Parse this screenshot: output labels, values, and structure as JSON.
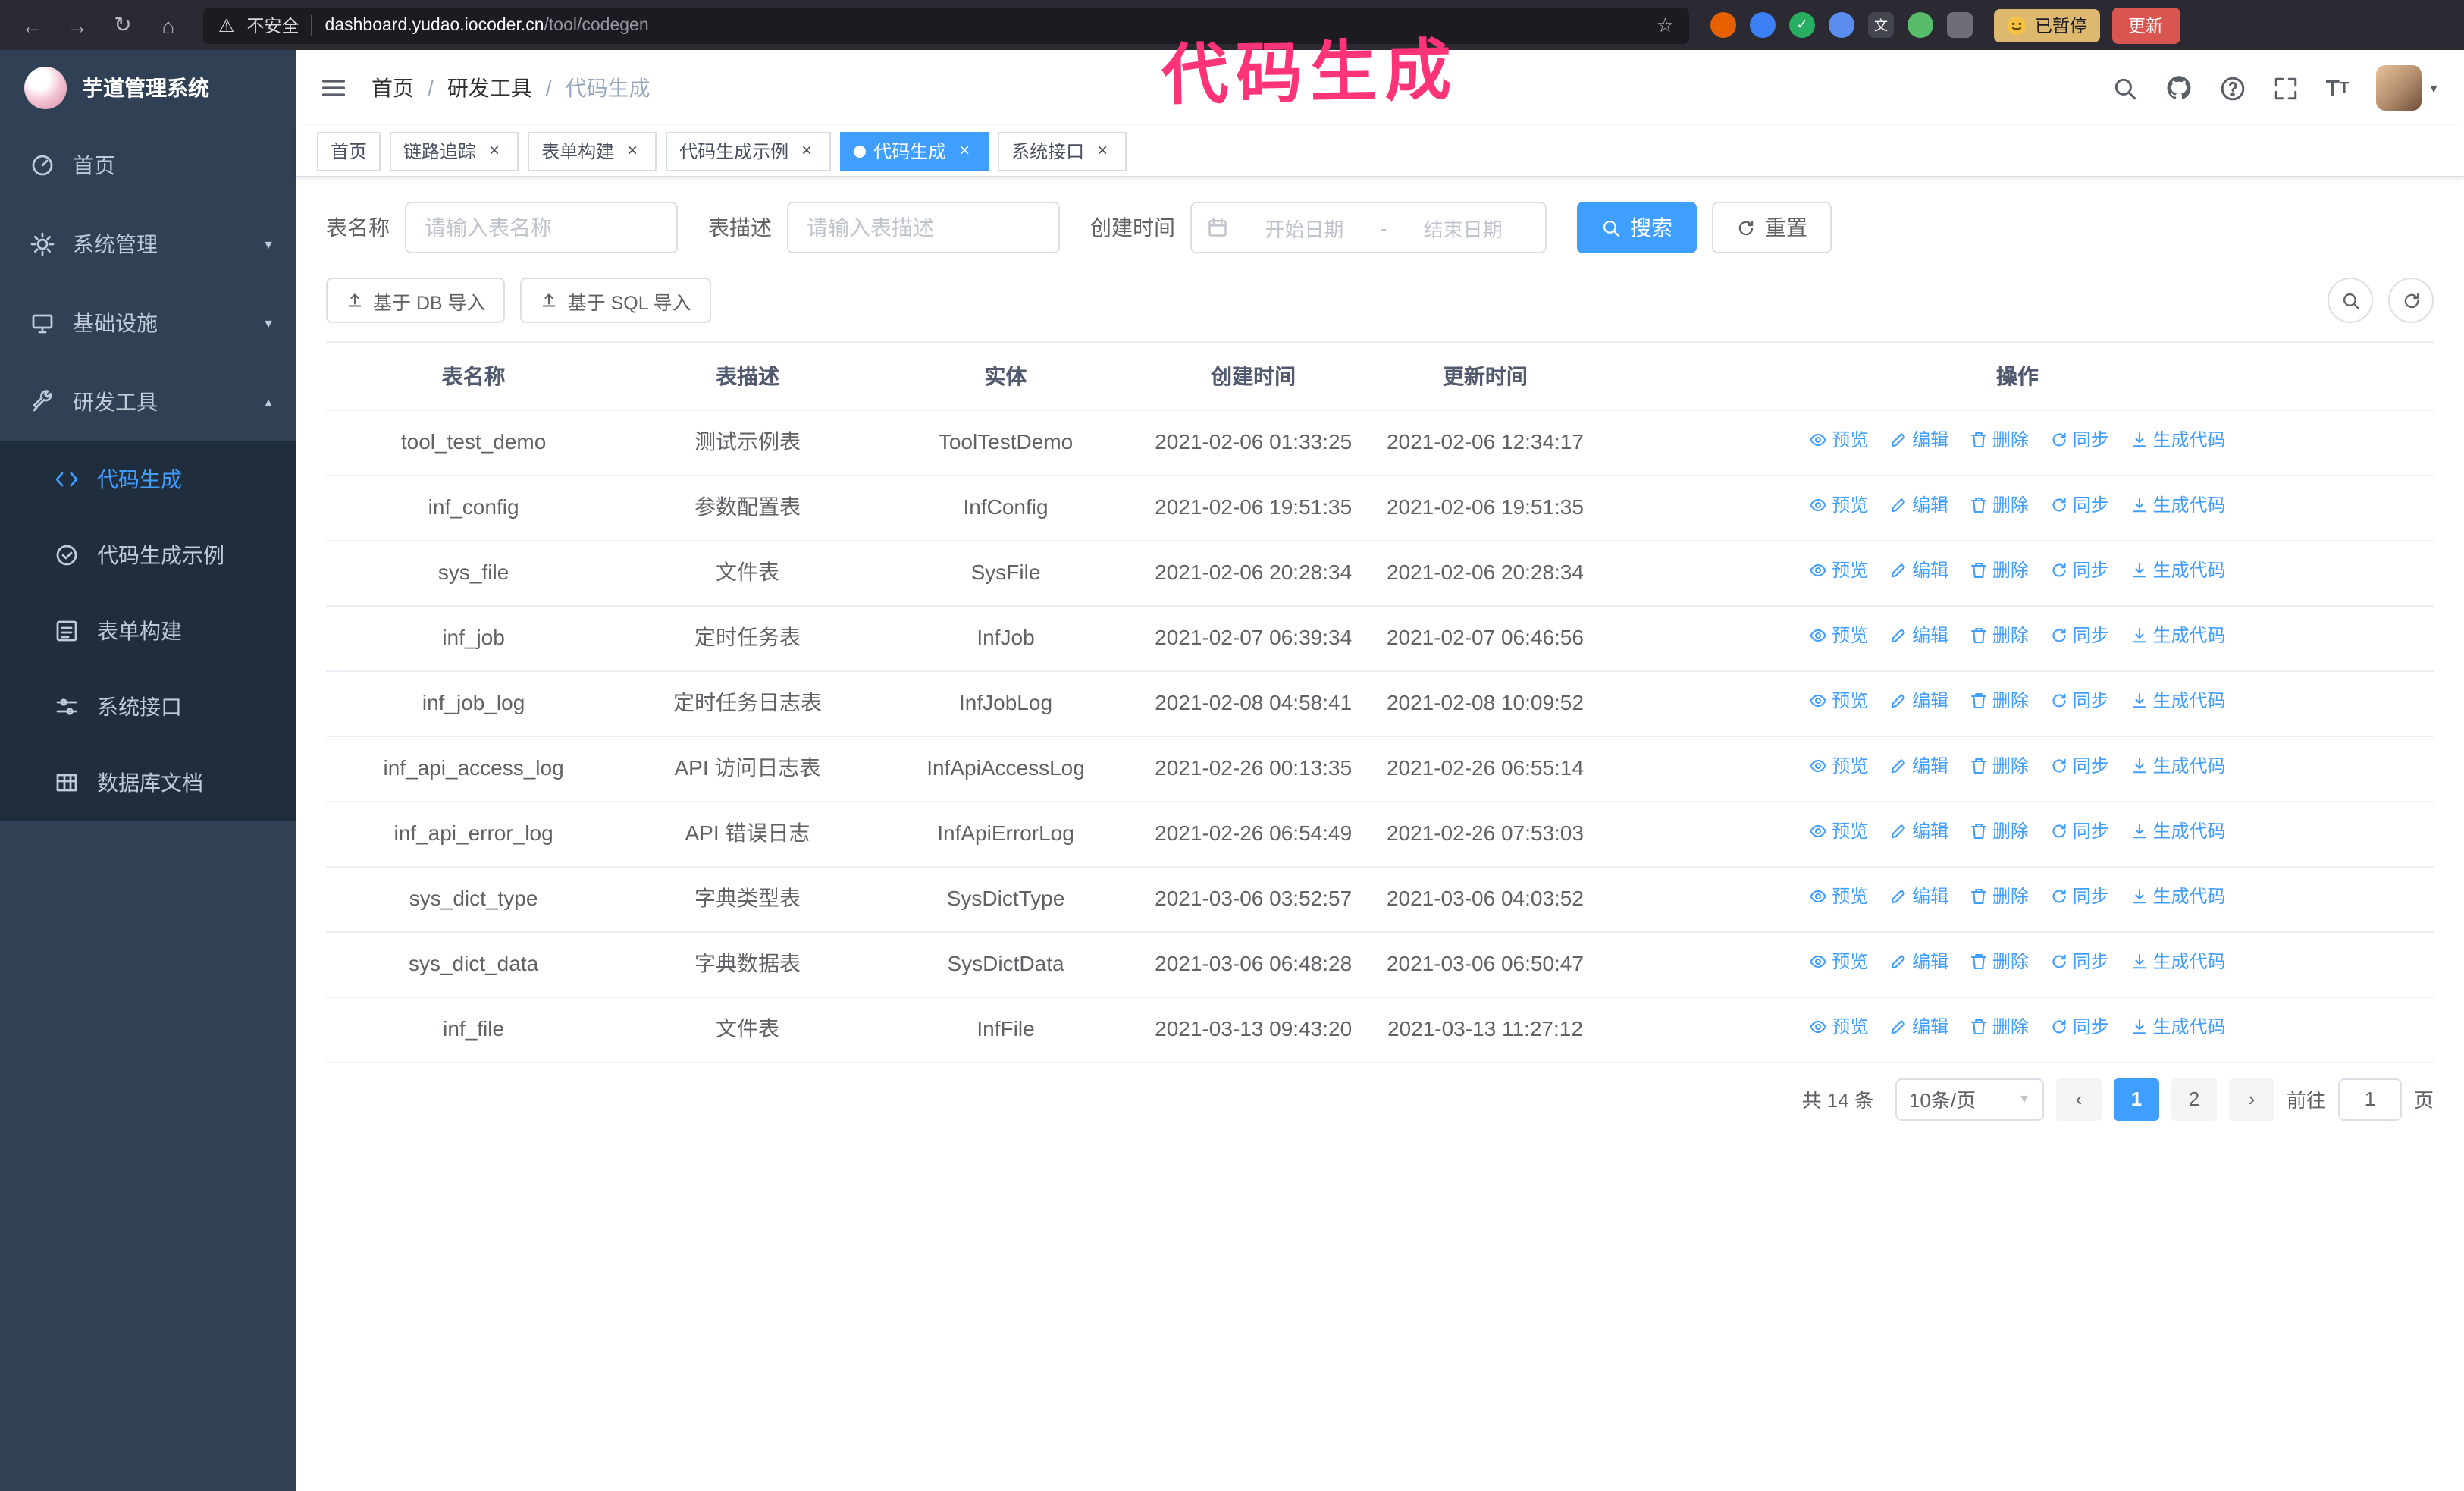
{
  "annotation": "代码生成",
  "browser": {
    "security_label": "不安全",
    "url_domain": "dashboard.yudao.iocoder.cn",
    "url_path": "/tool/codegen",
    "paused_badge": "已暂停",
    "update_button": "更新"
  },
  "icons": {
    "back": "←",
    "forward": "→",
    "reload": "↻",
    "home": "⌂",
    "warning": "⚠",
    "star": "☆",
    "close": "×",
    "chevron_down": "▼",
    "chevron_up": "▲",
    "prev": "‹",
    "next": "›",
    "dropdown": "▼"
  },
  "sidebar": {
    "logo_title": "芋道管理系统",
    "items": [
      {
        "label": "首页"
      },
      {
        "label": "系统管理"
      },
      {
        "label": "基础设施"
      },
      {
        "label": "研发工具"
      }
    ],
    "subitems": [
      {
        "label": "代码生成"
      },
      {
        "label": "代码生成示例"
      },
      {
        "label": "表单构建"
      },
      {
        "label": "系统接口"
      },
      {
        "label": "数据库文档"
      }
    ]
  },
  "header": {
    "separator": "/",
    "breadcrumb": [
      "首页",
      "研发工具",
      "代码生成"
    ]
  },
  "tabs": [
    {
      "label": "首页"
    },
    {
      "label": "链路追踪"
    },
    {
      "label": "表单构建"
    },
    {
      "label": "代码生成示例"
    },
    {
      "label": "代码生成"
    },
    {
      "label": "系统接口"
    }
  ],
  "filters": {
    "table_name_label": "表名称",
    "table_name_placeholder": "请输入表名称",
    "table_desc_label": "表描述",
    "table_desc_placeholder": "请输入表描述",
    "create_time_label": "创建时间",
    "date_start_placeholder": "开始日期",
    "date_separator": "-",
    "date_end_placeholder": "结束日期",
    "search_button": "搜索",
    "reset_button": "重置"
  },
  "toolbar": {
    "import_db_label": "基于 DB 导入",
    "import_sql_label": "基于 SQL 导入"
  },
  "table": {
    "columns": [
      "表名称",
      "表描述",
      "实体",
      "创建时间",
      "更新时间",
      "操作"
    ],
    "action_labels": [
      "预览",
      "编辑",
      "删除",
      "同步",
      "生成代码"
    ],
    "rows": [
      {
        "name": "tool_test_demo",
        "desc": "测试示例表",
        "entity": "ToolTestDemo",
        "created": "2021-02-06 01:33:25",
        "updated": "2021-02-06 12:34:17"
      },
      {
        "name": "inf_config",
        "desc": "参数配置表",
        "entity": "InfConfig",
        "created": "2021-02-06 19:51:35",
        "updated": "2021-02-06 19:51:35"
      },
      {
        "name": "sys_file",
        "desc": "文件表",
        "entity": "SysFile",
        "created": "2021-02-06 20:28:34",
        "updated": "2021-02-06 20:28:34"
      },
      {
        "name": "inf_job",
        "desc": "定时任务表",
        "entity": "InfJob",
        "created": "2021-02-07 06:39:34",
        "updated": "2021-02-07 06:46:56"
      },
      {
        "name": "inf_job_log",
        "desc": "定时任务日志表",
        "entity": "InfJobLog",
        "created": "2021-02-08 04:58:41",
        "updated": "2021-02-08 10:09:52"
      },
      {
        "name": "inf_api_access_log",
        "desc": "API 访问日志表",
        "entity": "InfApiAccessLog",
        "created": "2021-02-26 00:13:35",
        "updated": "2021-02-26 06:55:14"
      },
      {
        "name": "inf_api_error_log",
        "desc": "API 错误日志",
        "entity": "InfApiErrorLog",
        "created": "2021-02-26 06:54:49",
        "updated": "2021-02-26 07:53:03"
      },
      {
        "name": "sys_dict_type",
        "desc": "字典类型表",
        "entity": "SysDictType",
        "created": "2021-03-06 03:52:57",
        "updated": "2021-03-06 04:03:52"
      },
      {
        "name": "sys_dict_data",
        "desc": "字典数据表",
        "entity": "SysDictData",
        "created": "2021-03-06 06:48:28",
        "updated": "2021-03-06 06:50:47"
      },
      {
        "name": "inf_file",
        "desc": "文件表",
        "entity": "InfFile",
        "created": "2021-03-13 09:43:20",
        "updated": "2021-03-13 11:27:12"
      }
    ]
  },
  "pagination": {
    "total_label": "共 14 条",
    "page_size_label": "10条/页",
    "page_1": "1",
    "page_2": "2",
    "goto_label": "前往",
    "goto_value": "1",
    "goto_unit": "页"
  }
}
